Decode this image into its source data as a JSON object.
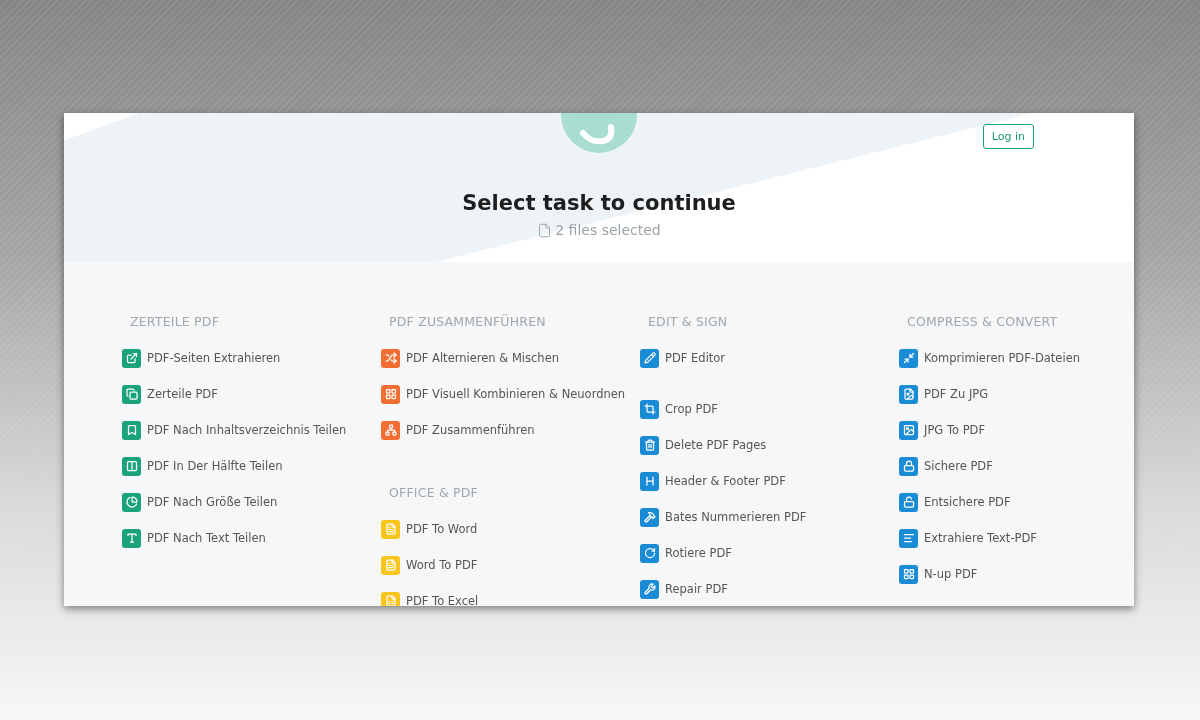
{
  "header": {
    "login_button": "Log in"
  },
  "hero": {
    "title": "Select task to continue",
    "subtitle": "2 files selected"
  },
  "columns": [
    {
      "sections": [
        {
          "title": "ZERTEILE PDF",
          "color": "#1aa37a",
          "groups": [
            [
              "PDF-Seiten Extrahieren",
              "Zerteile PDF",
              "PDF Nach Inhaltsverzeichnis Teilen",
              "PDF In Der Hälfte Teilen",
              "PDF Nach Größe Teilen",
              "PDF Nach Text Teilen"
            ]
          ]
        }
      ]
    },
    {
      "sections": [
        {
          "title": "PDF ZUSAMMENFÜHREN",
          "color": "#f26d32",
          "groups": [
            [
              "PDF Alternieren & Mischen",
              "PDF Visuell Kombinieren & Neuordnen",
              "PDF Zusammenführen"
            ]
          ]
        },
        {
          "title": "OFFICE & PDF",
          "color": "#f7c51e",
          "groups": [
            [
              "PDF To Word",
              "Word To PDF",
              "PDF To Excel"
            ]
          ]
        }
      ]
    },
    {
      "sections": [
        {
          "title": "EDIT & SIGN",
          "color": "#1b8bd6",
          "groups": [
            [
              "PDF Editor"
            ],
            [
              "Crop PDF",
              "Delete PDF Pages",
              "Header & Footer PDF",
              "Bates Nummerieren PDF",
              "Rotiere PDF",
              "Repair PDF"
            ]
          ]
        }
      ]
    },
    {
      "sections": [
        {
          "title": "COMPRESS & CONVERT",
          "color": "#1b8bd6",
          "groups": [
            [
              "Komprimieren PDF-Dateien",
              "PDF Zu JPG",
              "JPG To PDF",
              "Sichere PDF",
              "Entsichere PDF",
              "Extrahiere Text-PDF",
              "N-up PDF"
            ]
          ]
        }
      ]
    }
  ]
}
